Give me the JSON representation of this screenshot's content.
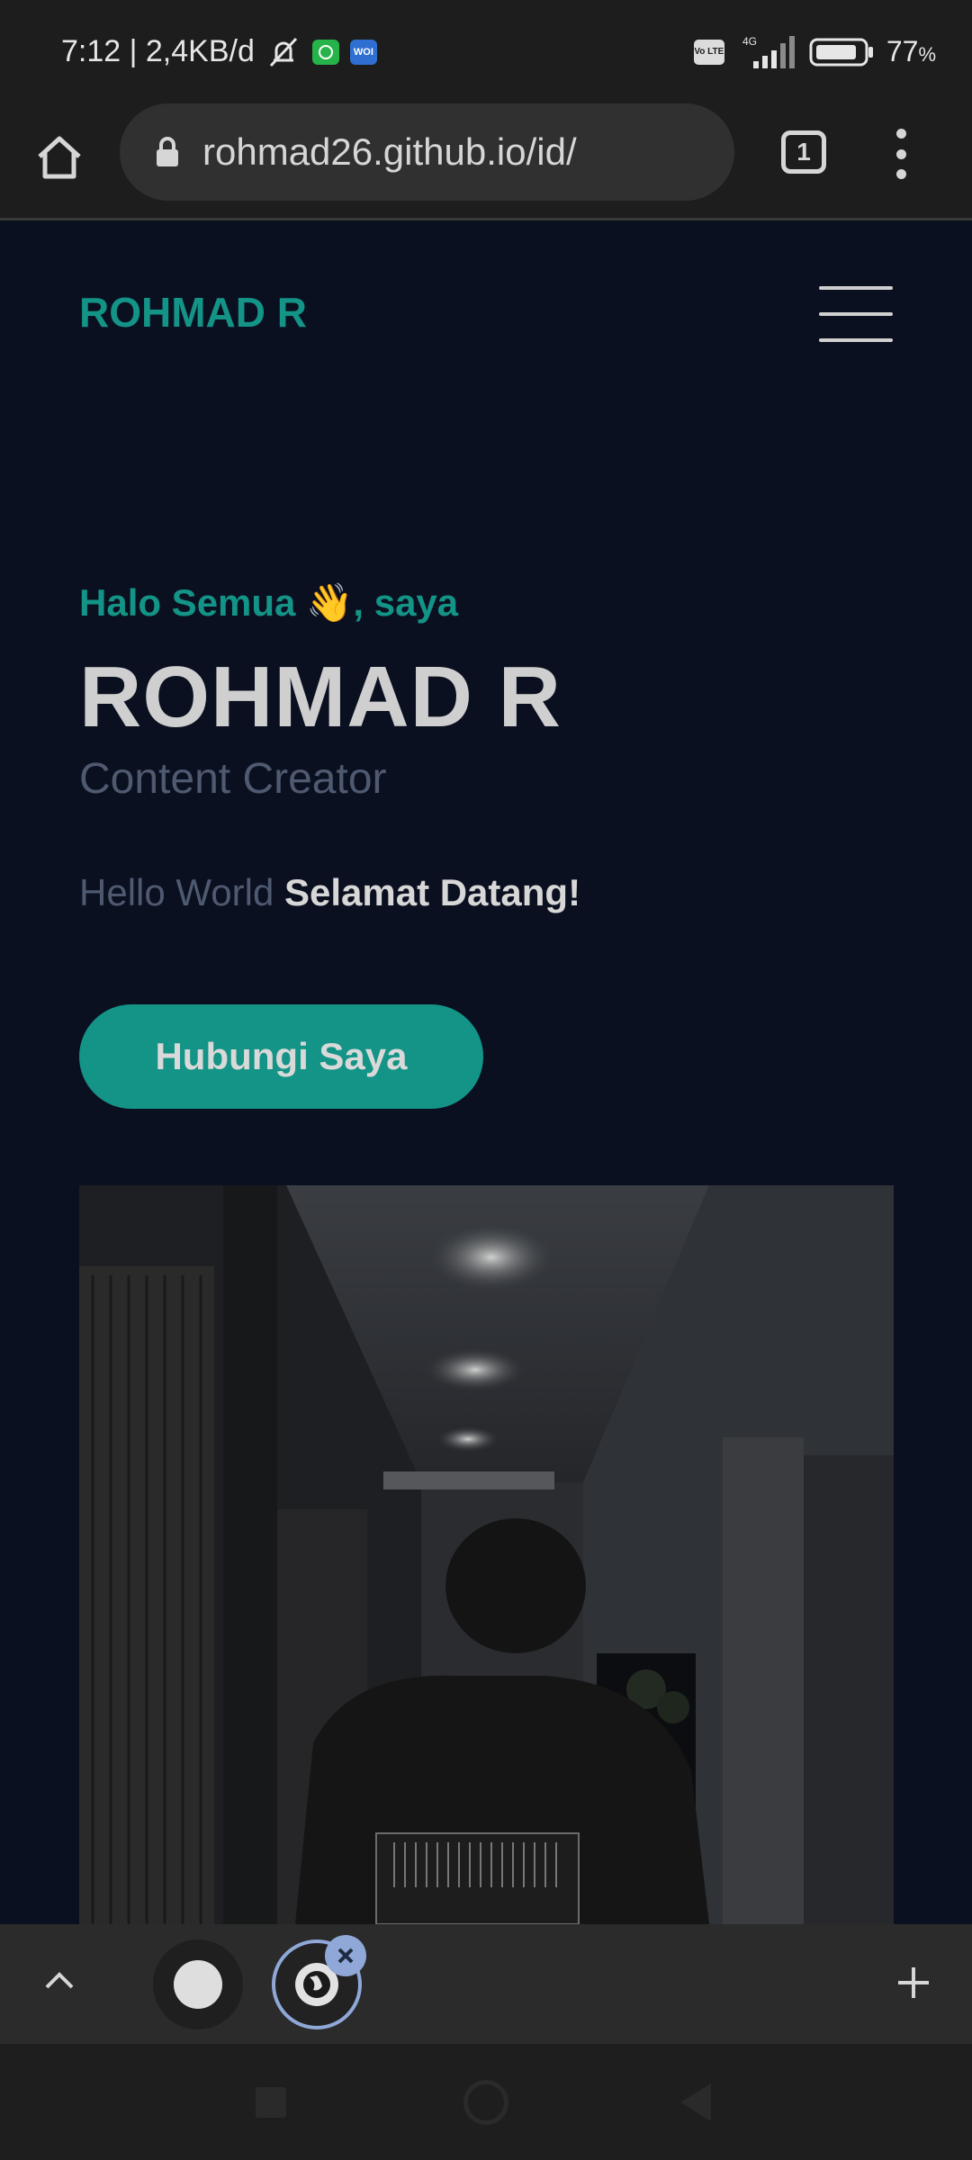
{
  "status_bar": {
    "time_and_speed": "7:12 | 2,4KB/d",
    "notification_icons": [
      "mute-bell-icon",
      "whatsapp-icon",
      "woi-app-icon"
    ],
    "woi_label": "WOI",
    "volte_label": "Vo LTE",
    "network_type": "4G",
    "battery_percent": "77",
    "battery_percent_symbol": "%"
  },
  "browser": {
    "url": "rohmad26.github.io/id/",
    "tab_count": "1"
  },
  "site": {
    "brand": "ROHMAD R",
    "greeting": "Halo Semua 👋, saya",
    "name": "ROHMAD R",
    "role": "Content Creator",
    "welcome_muted": "Hello World",
    "welcome_strong": "Selamat Datang!",
    "cta_label": "Hubungi Saya"
  },
  "colors": {
    "accent": "#139486",
    "page_background": "#0b1021",
    "browser_chrome": "#1d1d1d",
    "tab_highlight": "#8fa8d8"
  }
}
